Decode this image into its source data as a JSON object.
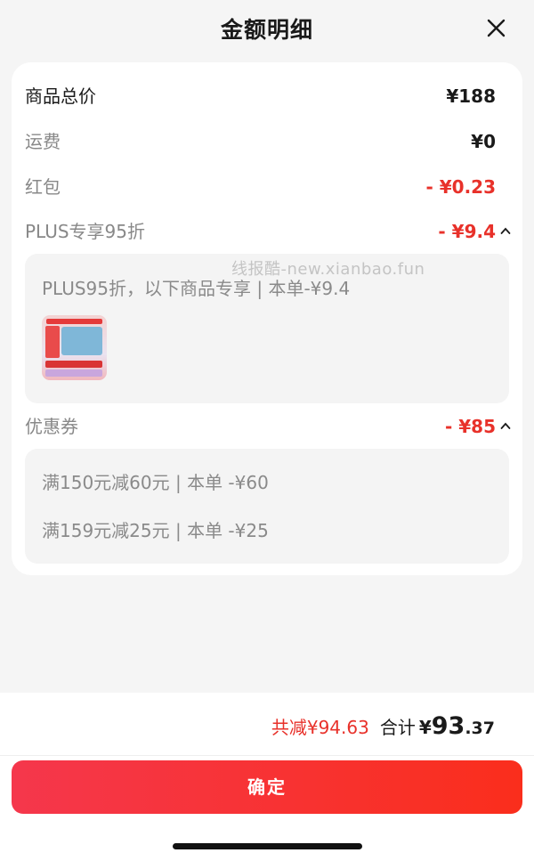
{
  "header": {
    "title": "金额明细"
  },
  "breakdown": {
    "rows": [
      {
        "label": "商品总价",
        "value": "¥188"
      },
      {
        "label": "运费",
        "value": "¥0"
      },
      {
        "label": "红包",
        "value": "- ¥0.23"
      },
      {
        "label": "PLUS专享95折",
        "value": "- ¥9.4"
      }
    ],
    "plus_detail": {
      "text": "PLUS95折，以下商品专享 | 本单-¥9.4"
    },
    "coupon": {
      "label": "优惠券",
      "value": "- ¥85",
      "items": [
        "满150元减60元 | 本单 -¥60",
        "满159元减25元 | 本单 -¥25"
      ]
    }
  },
  "watermark": "线报酷-new.xianbao.fun",
  "footer": {
    "saved": "共减¥94.63",
    "total_label": "合计",
    "currency": "¥",
    "total_int": "93",
    "total_dec": ".37",
    "confirm_label": "确定"
  },
  "colors": {
    "accent_red": "#e8312a",
    "button_start": "#f5374c",
    "button_end": "#fa2e1c"
  },
  "icons": {
    "close": "close-icon",
    "chevron": "chevron-up-icon"
  }
}
